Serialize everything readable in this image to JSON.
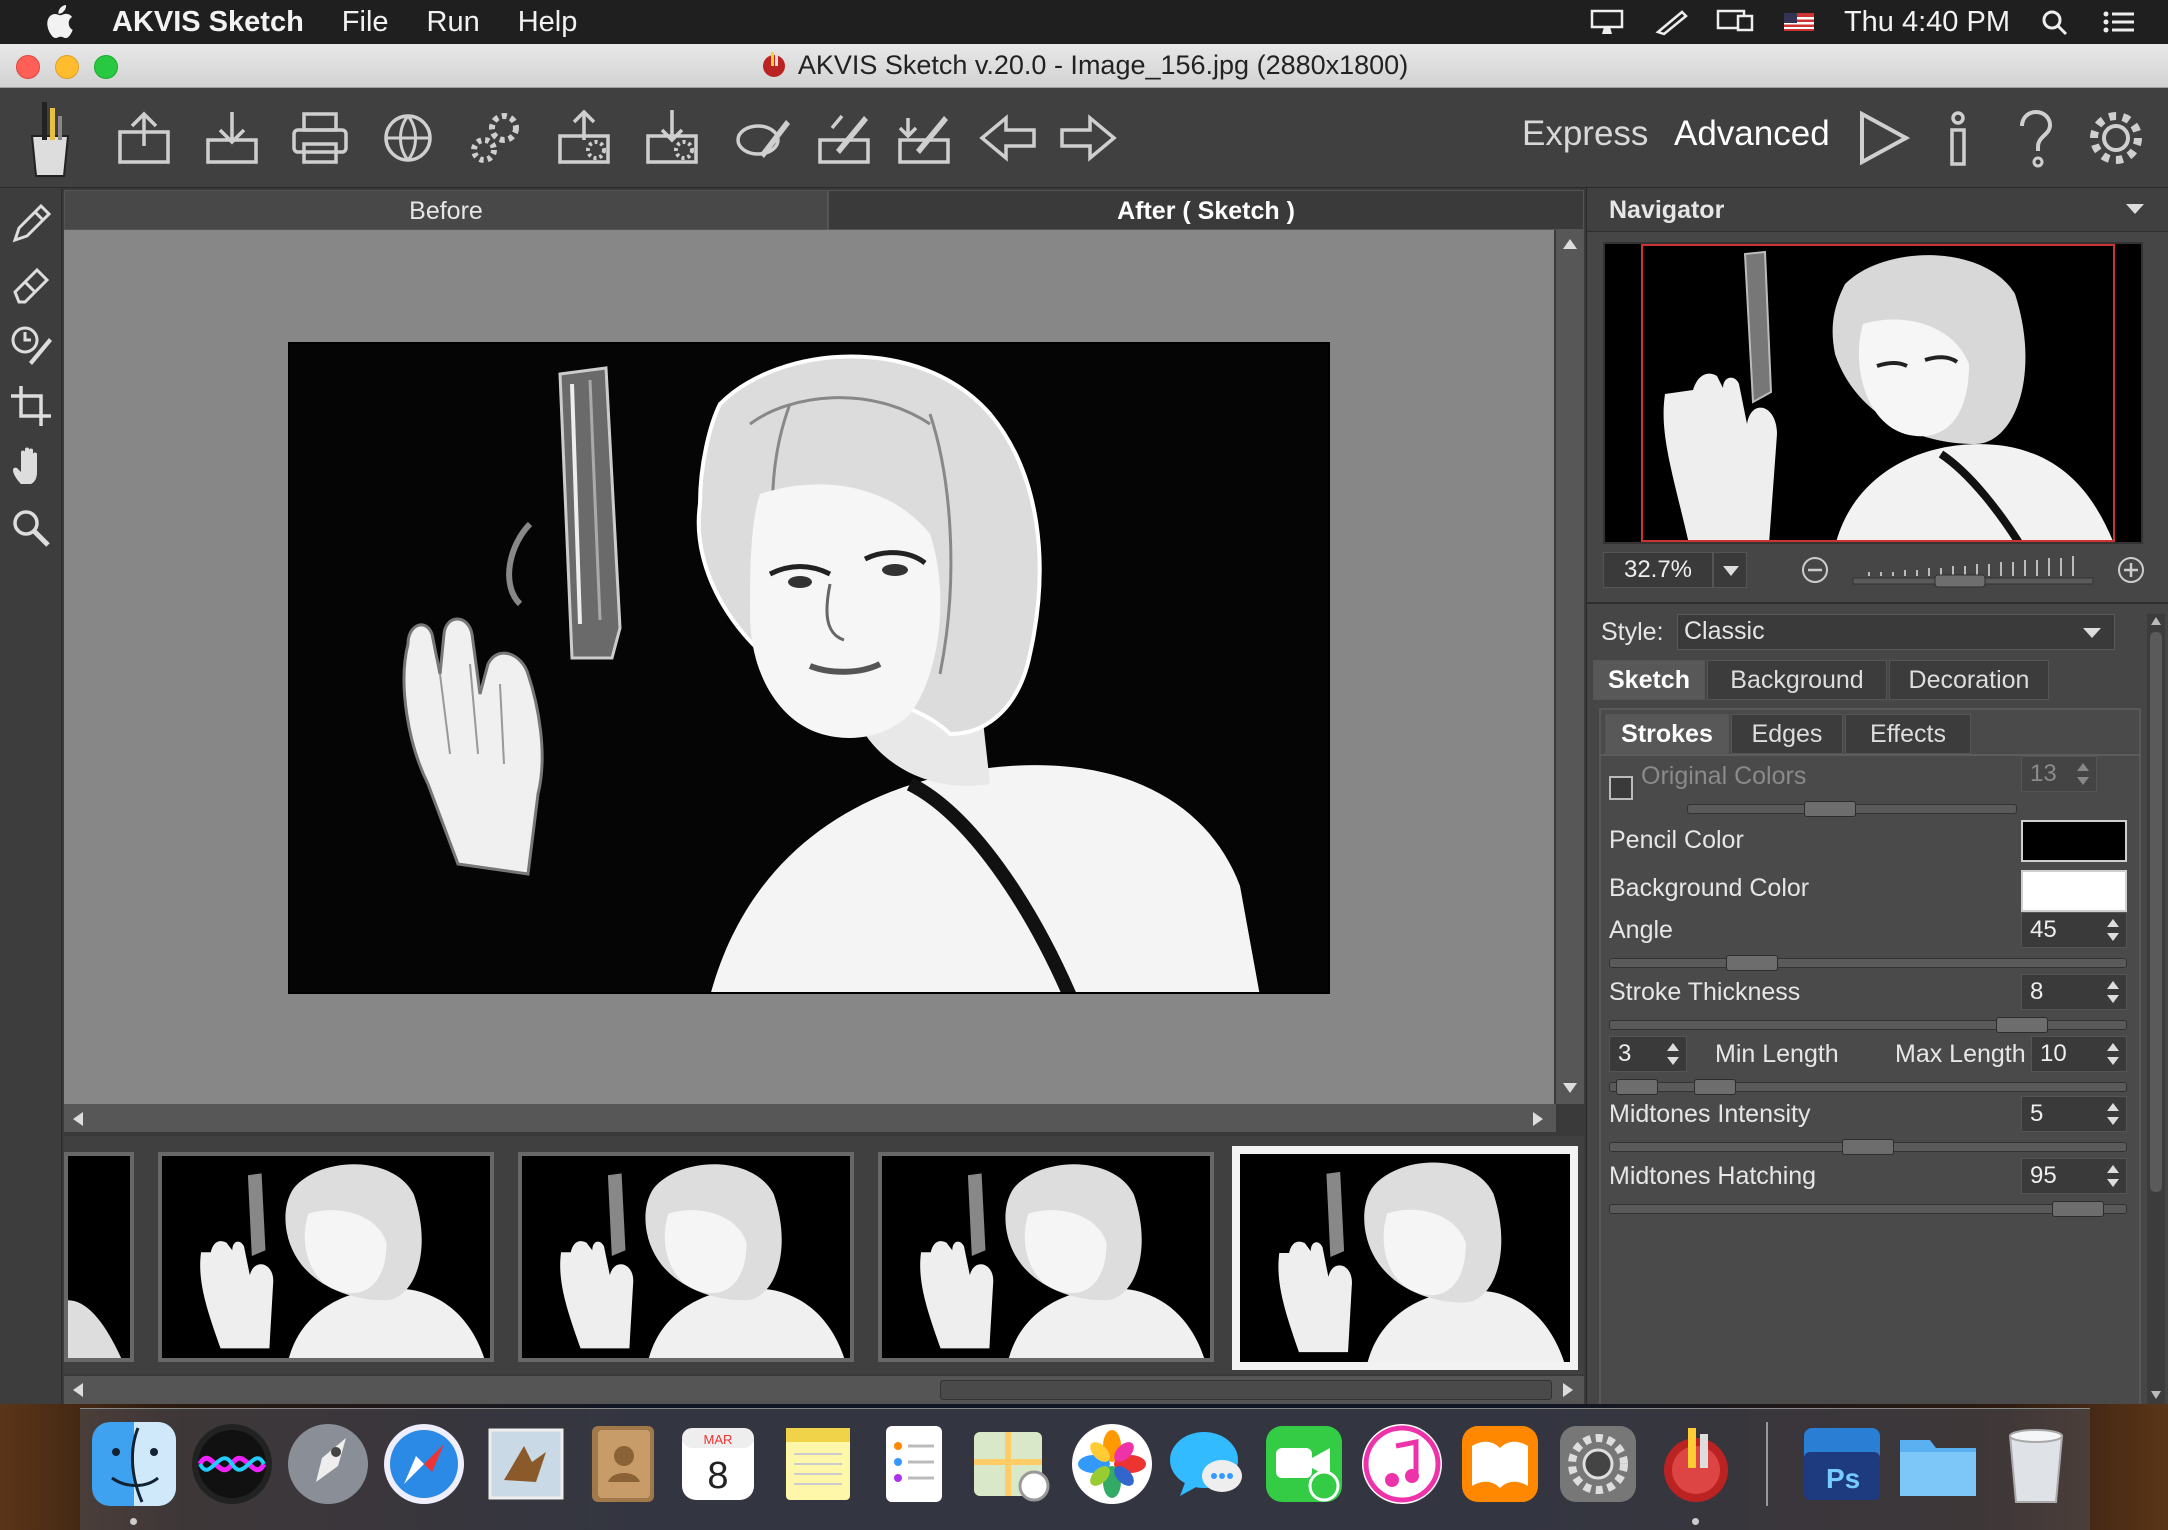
{
  "menubar": {
    "app_name": "AKVIS Sketch",
    "items": [
      "File",
      "Run",
      "Help"
    ],
    "clock": "Thu 4:40 PM"
  },
  "window": {
    "title": "AKVIS Sketch v.20.0 - Image_156.jpg (2880x1800)"
  },
  "toolbar": {
    "express_label": "Express",
    "advanced_label": "Advanced",
    "icons": [
      "open-icon",
      "save-icon",
      "print-icon",
      "publish-icon",
      "batch-icon",
      "load-preset-icon",
      "save-preset-icon",
      "undo-stroke-icon",
      "export-icon",
      "import-icon",
      "undo-icon",
      "redo-icon"
    ]
  },
  "view_tabs": {
    "before": "Before",
    "after": "After ( Sketch )"
  },
  "navigator": {
    "title": "Navigator",
    "zoom": "32.7%"
  },
  "settings": {
    "style_label": "Style:",
    "style_value": "Classic",
    "tabs": [
      "Sketch",
      "Background",
      "Decoration"
    ],
    "subtabs": [
      "Strokes",
      "Edges",
      "Effects"
    ],
    "original_colors_label": "Original Colors",
    "original_colors_value": "13",
    "original_colors_checked": false,
    "pencil_color_label": "Pencil Color",
    "pencil_color": "#000000",
    "background_color_label": "Background Color",
    "background_color": "#ffffff",
    "angle_label": "Angle",
    "angle_value": "45",
    "stroke_thickness_label": "Stroke Thickness",
    "stroke_thickness_value": "8",
    "min_length_value": "3",
    "min_length_label": "Min Length",
    "max_length_label": "Max Length",
    "max_length_value": "10",
    "midtones_intensity_label": "Midtones Intensity",
    "midtones_intensity_value": "5",
    "midtones_hatching_label": "Midtones Hatching",
    "midtones_hatching_value": "95"
  },
  "dock": {
    "calendar_month": "MAR",
    "calendar_day": "8",
    "ps_label": "Ps"
  }
}
